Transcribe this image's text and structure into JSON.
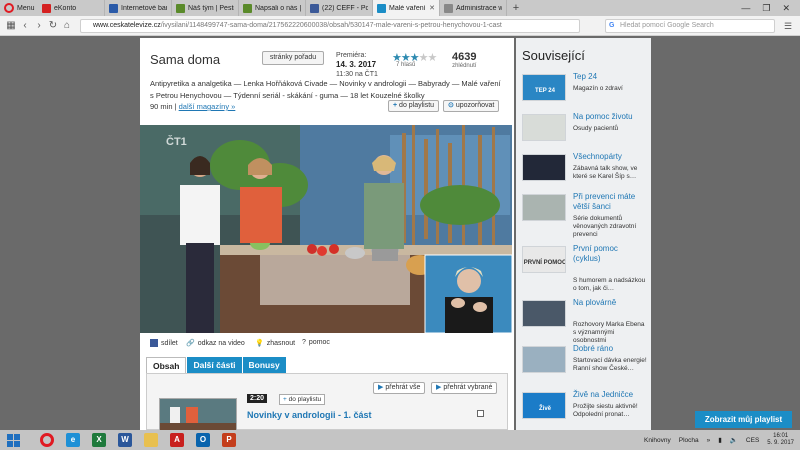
{
  "browser": {
    "menu_label": "Menu",
    "tabs": [
      {
        "title": "eKonto",
        "color": "#d42020"
      },
      {
        "title": "Internetové bankovnic",
        "color": "#2a5aa8"
      },
      {
        "title": "Náš tým | Pestrá strava",
        "color": "#5a8a2a"
      },
      {
        "title": "Napsali o nás | Pestrá s",
        "color": "#5a8a2a"
      },
      {
        "title": "(22) CEFF - Podpořte p",
        "color": "#3b5998"
      },
      {
        "title": "Malé vaření s Petrou H",
        "color": "#1b8dc6",
        "active": true
      },
      {
        "title": "Administrace webu",
        "color": "#888888"
      }
    ],
    "url_host": "www.ceskatelevize.cz",
    "url_path": "/ivysilani/1148499747-sama-doma/217562220600038/obsah/530147-male-vareni-s-petrou-henychovou-1-cast",
    "search_placeholder": "Hledat pomocí Google Search"
  },
  "program": {
    "title": "Sama doma",
    "program_button": "stránky pořadu",
    "premiere_label": "Premiéra:",
    "premiere_date": "14. 3. 2017",
    "premiere_time": "11:30 na ČT1",
    "rating_stars": 3,
    "votes_text": "7 hlasů",
    "views": "4639",
    "views_label": "zhlédnutí",
    "description": "Antipyretika a analgetika — Lenka Hořňáková Civade — Novinky v andrologii — Babyrady — Malé vaření s Petrou Henychovou — Týdenní seriál - skákání - guma — 18 let Kouzelné školky",
    "duration": "90 min",
    "more_magazines": "další magazíny »",
    "add_playlist": "do playlistu",
    "notify": "upozorňovat",
    "logo": "ČT1"
  },
  "share": {
    "share": "sdílet",
    "link": "odkaz na video",
    "light": "zhasnout",
    "help": "pomoc"
  },
  "content_tabs": [
    {
      "label": "Obsah",
      "active": true
    },
    {
      "label": "Další části"
    },
    {
      "label": "Bonusy"
    }
  ],
  "content_panel": {
    "play_all": "přehrát vše",
    "play_selected": "přehrát vybrané",
    "item_duration": "2:20",
    "item_add": "do playlistu",
    "item_title": "Novinky v andrologii - 1. část"
  },
  "related": {
    "heading": "Související",
    "items": [
      {
        "title": "Tep 24",
        "desc": "Magazín o zdraví",
        "thumb_text": "TEP 24"
      },
      {
        "title": "Na pomoc životu",
        "desc": "Osudy pacientů",
        "thumb_text": ""
      },
      {
        "title": "Všechnopárty",
        "desc": "Zábavná talk show, ve které se Karel Šíp s…",
        "thumb_text": ""
      },
      {
        "title": "Při prevenci máte větší šanci",
        "desc": "Série dokumentů věnovaných zdravotní prevenci",
        "thumb_text": ""
      },
      {
        "title": "První pomoc (cyklus)",
        "desc": "S humorem a nadsázkou o tom, jak či…",
        "thumb_text": "PRVNÍ POMOC"
      },
      {
        "title": "Na plovárně",
        "desc": "Rozhovory Marka Ebena s významnými osobnostmi",
        "thumb_text": ""
      },
      {
        "title": "Dobré ráno",
        "desc": "Startovací dávka energie! Ranní show České…",
        "thumb_text": ""
      },
      {
        "title": "Živě na Jedničce",
        "desc": "Prožijte siestu aktivně! Odpolední pronat…",
        "thumb_text": "Živě"
      }
    ]
  },
  "playlist_button": "Zobrazit můj playlist",
  "taskbar": {
    "tray_items": [
      "Knihovny",
      "Plocha"
    ],
    "lang": "CES",
    "time": "16:01",
    "date": "5. 9. 2017"
  }
}
